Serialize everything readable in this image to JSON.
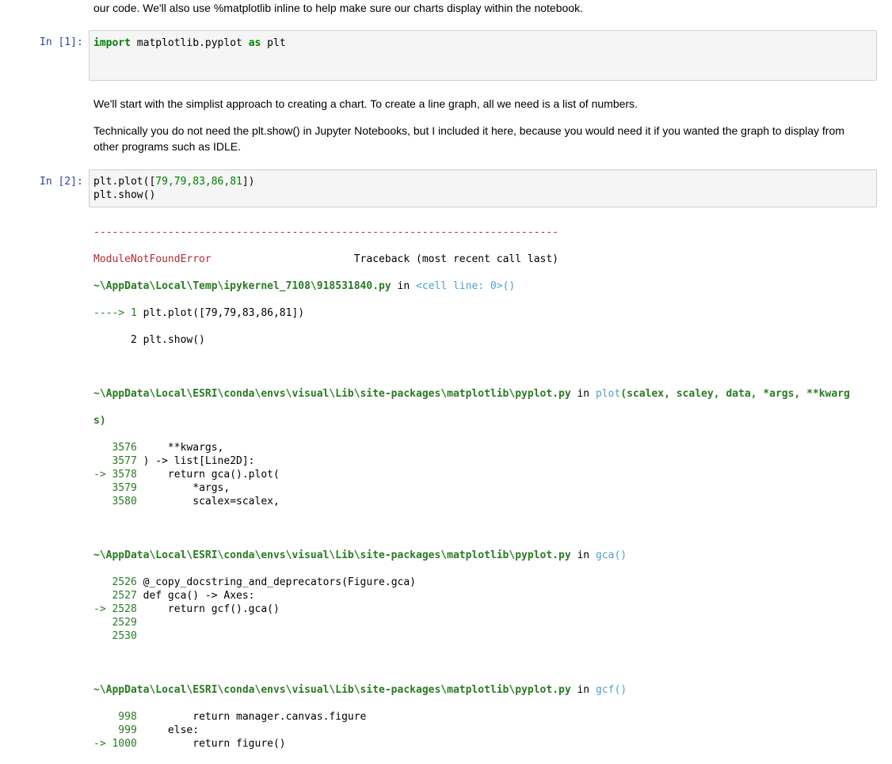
{
  "md_top": "our code. We'll also use %matplotlib inline to help make sure our charts display within the notebook.",
  "cell1": {
    "prompt": "In [1]:",
    "code_kw1": "import",
    "code_mod": " matplotlib.pyplot ",
    "code_kw2": "as",
    "code_alias": " plt"
  },
  "md2_p1": "We'll start with the simplist approach to creating a chart. To create a line graph, all we need is a list of numbers.",
  "md2_p2": "Technically you do not need the plt.show() in Jupyter Notebooks, but I included it here, because you would need it if you wanted the graph to display from other programs such as IDLE.",
  "cell2": {
    "prompt": "In [2]:",
    "line1_a": "plt.plot([",
    "line1_nums": "79,79,83,86,81",
    "line1_b": "])",
    "line2": "plt.show()"
  },
  "tb": {
    "dashes": "---------------------------------------------------------------------------",
    "err_name": "ModuleNotFoundError",
    "traceback_hdr": "                       Traceback (most recent call last)",
    "f1_path": "~\\AppData\\Local\\Temp\\ipykernel_7108\\918531840.py",
    "in": " in ",
    "f1_cell": "<cell line: 0>()",
    "f1_l1_arrow": "----> 1 ",
    "f1_l1_code": "plt.plot([79,79,83,86,81])",
    "f1_l2": "      2 plt.show()",
    "f2_path": "~\\AppData\\Local\\ESRI\\conda\\envs\\visual\\Lib\\site-packages\\matplotlib\\pyplot.py",
    "f2_func": "plot",
    "f2_args": "(scalex, scaley, data, *args, **kwarg",
    "f2_args_wrap": "s)",
    "f2_lines": [
      {
        "n": "   3576",
        "code": "     **kwargs,"
      },
      {
        "n": "   3577",
        "code": " ) -> list[Line2D]:"
      },
      {
        "n": "-> 3578",
        "code": "     return gca().plot("
      },
      {
        "n": "   3579",
        "code": "         *args,"
      },
      {
        "n": "   3580",
        "code": "         scalex=scalex,"
      }
    ],
    "f3_path": "~\\AppData\\Local\\ESRI\\conda\\envs\\visual\\Lib\\site-packages\\matplotlib\\pyplot.py",
    "f3_func": "gca()",
    "f3_lines": [
      {
        "n": "   2526",
        "code": " @_copy_docstring_and_deprecators(Figure.gca)"
      },
      {
        "n": "   2527",
        "code": " def gca() -> Axes:"
      },
      {
        "n": "-> 2528",
        "code": "     return gcf().gca()"
      },
      {
        "n": "   2529",
        "code": ""
      },
      {
        "n": "   2530",
        "code": ""
      }
    ],
    "f4_path": "~\\AppData\\Local\\ESRI\\conda\\envs\\visual\\Lib\\site-packages\\matplotlib\\pyplot.py",
    "f4_func": "gcf()",
    "f4_lines": [
      {
        "n": "    998",
        "code": "         return manager.canvas.figure"
      },
      {
        "n": "    999",
        "code": "     else:"
      },
      {
        "n": "-> 1000",
        "code": "         return figure()"
      }
    ]
  }
}
